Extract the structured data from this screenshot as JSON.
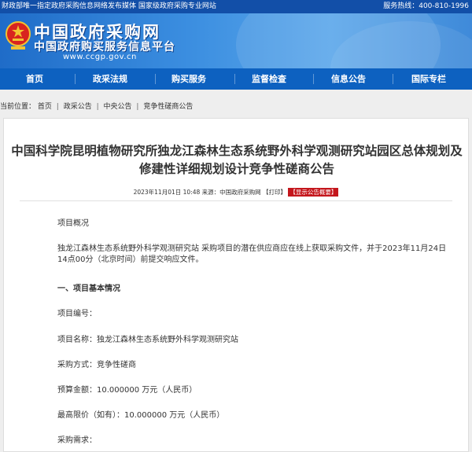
{
  "topbar": {
    "left_text": "财政部唯一指定政府采购信息网络发布媒体 国家级政府采购专业网站",
    "hotline": "服务热线：400-810-1996"
  },
  "header": {
    "logo_title": "中国政府采购网",
    "logo_subtitle": "中国政府购买服务信息平台",
    "logo_url": "www.ccgp.gov.cn"
  },
  "nav": {
    "items": [
      "首页",
      "政采法规",
      "购买服务",
      "监督检查",
      "信息公告",
      "国际专栏"
    ]
  },
  "breadcrumb": {
    "prefix": "当前位置：",
    "items": [
      "首页",
      "政采公告",
      "中央公告",
      "竞争性磋商公告"
    ],
    "separator": "|"
  },
  "article": {
    "title": "中国科学院昆明植物研究所独龙江森林生态系统野外科学观测研究站园区总体规划及修建性详细规划设计竞争性磋商公告",
    "meta_date": "2023年11月01日 10:48",
    "meta_source": "来源：中国政府采购网",
    "meta_print": "【打印】",
    "meta_badge": "【显示公告概要】",
    "paragraphs": [
      "项目概况",
      "独龙江森林生态系统野外科学观测研究站 采购项目的潜在供应商应在线上获取采购文件，并于2023年11月24日 14点00分（北京时间）前提交响应文件。",
      "一、项目基本情况",
      "项目编号：",
      "项目名称：独龙江森林生态系统野外科学观测研究站",
      "采购方式：竞争性磋商",
      "预算金额：10.000000 万元（人民币）",
      "最高限价（如有）：10.000000 万元（人民币）",
      "采购需求："
    ]
  },
  "colors": {
    "topbar": "#124fa8",
    "nav": "#0d61c0",
    "badge": "#c4161c",
    "emblem": "#d8241f"
  }
}
